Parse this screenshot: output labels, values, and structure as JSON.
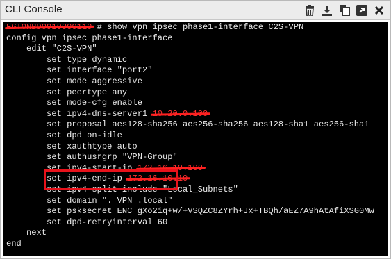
{
  "window": {
    "title": "CLI Console"
  },
  "toolbar": {
    "icons": [
      "trash-icon",
      "download-icon",
      "copy-icon",
      "expand-icon",
      "close-icon"
    ]
  },
  "console": {
    "hostname_redacted": "FGT0NBD0910000110",
    "prompt_suffix": " # show vpn ipsec phase1-interface C2S-VPN",
    "lines": [
      "config vpn ipsec phase1-interface",
      "    edit \"C2S-VPN\"",
      "        set type dynamic",
      "        set interface \"port2\"",
      "        set mode aggressive",
      "        set peertype any",
      "        set mode-cfg enable"
    ],
    "dns_prefix": "        set ipv4-dns-server1 ",
    "dns_redacted": "10.20.0.100",
    "lines2": [
      "        set proposal aes128-sha256 aes256-sha256 aes128-sha1 aes256-sha1",
      "        set dpd on-idle",
      "        set xauthtype auto",
      "        set authusrgrp \"VPN-Group\""
    ],
    "start_prefix": "        set ipv4-start-ip ",
    "start_redacted": "172.16.10.100",
    "end_prefix": "        set ipv4-end-ip ",
    "end_redacted": "172.16.10.10",
    "split_line": "        set ipv4-split-include \"Local_Subnets\"",
    "domain_line": "        set domain \". VPN .local\"",
    "psk_line": "        set psksecret ENC gXo2iq+w/+VSQZC8ZYrh+Jx+TBQh/aEZ7A9hAtAfiXSG0Mw",
    "lines3": [
      "        set dpd-retryinterval 60",
      "    next",
      "end"
    ]
  },
  "colors": {
    "console_bg": "#000000",
    "console_fg": "#e9e9e9",
    "redaction": "#ff2020",
    "highlight": "#e8121b"
  }
}
